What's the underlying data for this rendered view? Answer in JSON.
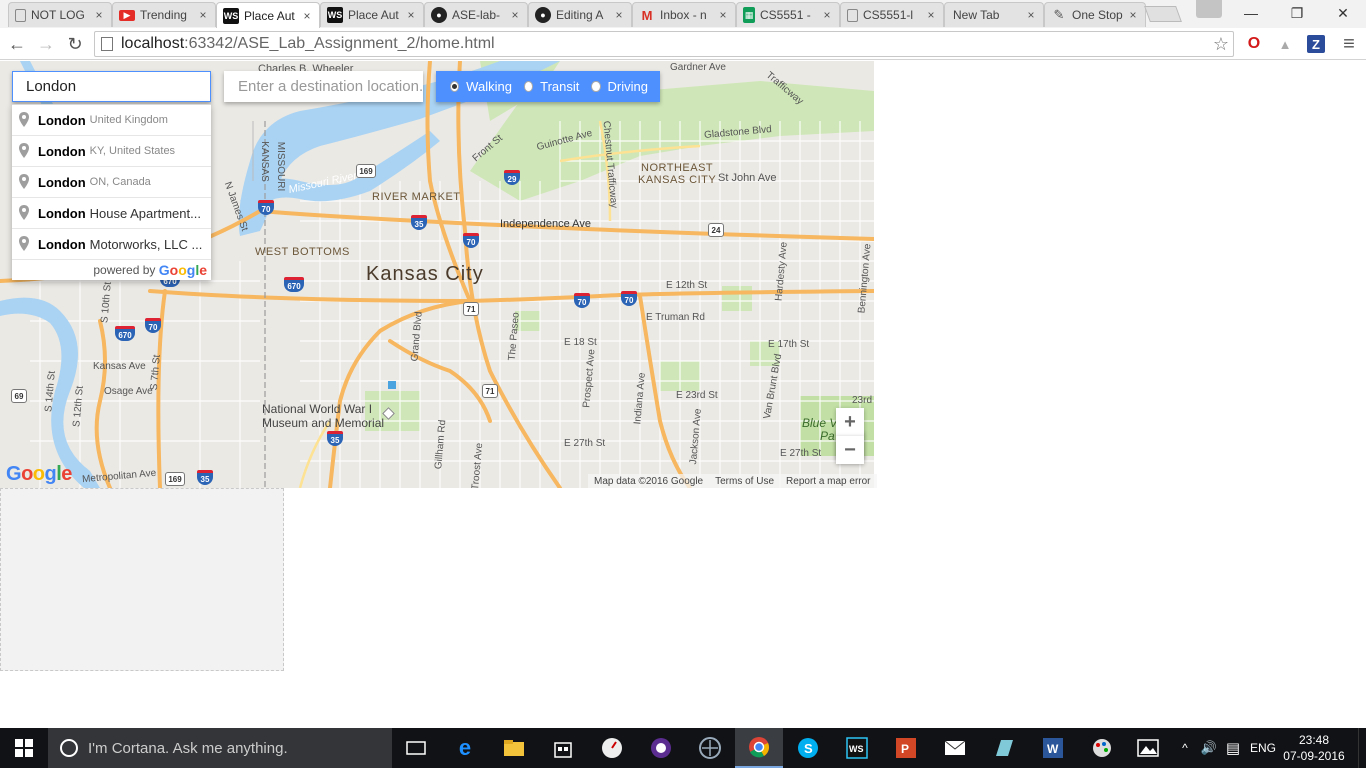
{
  "browser": {
    "tabs": [
      {
        "title": "NOT LOG",
        "favicon": "page-icon",
        "active": false
      },
      {
        "title": "Trending",
        "favicon": "youtube-icon",
        "active": false
      },
      {
        "title": "Place Aut",
        "favicon": "webstorm-icon",
        "active": true
      },
      {
        "title": "Place Aut",
        "favicon": "webstorm-icon",
        "active": false
      },
      {
        "title": "ASE-lab-",
        "favicon": "github-icon",
        "active": false
      },
      {
        "title": "Editing A",
        "favicon": "github-icon",
        "active": false
      },
      {
        "title": "Inbox - n",
        "favicon": "gmail-icon",
        "active": false
      },
      {
        "title": "CS5551 -",
        "favicon": "sheets-icon",
        "active": false
      },
      {
        "title": "CS5551-l",
        "favicon": "page-icon",
        "active": false
      },
      {
        "title": "New Tab",
        "favicon": "",
        "active": false
      },
      {
        "title": "One Stop",
        "favicon": "feather-icon",
        "active": false
      }
    ],
    "tab_close_glyph": "×",
    "window": {
      "minimize": "—",
      "restore": "❐",
      "close": "✕"
    },
    "url_host": "localhost",
    "url_path": ":63342/ASE_Lab_Assignment_2/home.html",
    "nav": {
      "back": "←",
      "forward": "→",
      "reload": "↻",
      "star": "☆",
      "menu": "≡"
    },
    "extensions": {
      "opera": "O",
      "drive": "▲",
      "z": "Z"
    }
  },
  "map": {
    "origin_value": "London",
    "destination_placeholder": "Enter a destination location...",
    "modes": [
      {
        "label": "Walking",
        "checked": true
      },
      {
        "label": "Transit",
        "checked": false
      },
      {
        "label": "Driving",
        "checked": false
      }
    ],
    "suggestions": [
      {
        "main": "London",
        "rest": "",
        "secondary": "United Kingdom"
      },
      {
        "main": "London",
        "rest": "",
        "secondary": "KY, United States"
      },
      {
        "main": "London",
        "rest": "",
        "secondary": "ON, Canada"
      },
      {
        "main": "London",
        "rest": "House Apartment...",
        "secondary": ""
      },
      {
        "main": "London",
        "rest": "Motorworks, LLC ...",
        "secondary": ""
      }
    ],
    "powered_by": "powered by",
    "google_letters": [
      "G",
      "o",
      "o",
      "g",
      "l",
      "e"
    ],
    "labels": {
      "city": "Kansas City",
      "river_market": "RIVER MARKET",
      "west_bottoms": "WEST BOTTOMS",
      "northeast_1": "NORTHEAST",
      "northeast_2": "KANSAS CITY",
      "missouri_river": "Missouri River",
      "independence": "Independence Ave",
      "e12th": "E 12th St",
      "truman": "E Truman Rd",
      "e18": "E 18 St",
      "e17": "E 17th St",
      "e23": "E 23rd St",
      "e27": "E 27th St",
      "e27b": "E 27th St",
      "stjohn": "St John Ave",
      "gladstone": "Gladstone Blvd",
      "guinotte": "Guinotte Ave",
      "front": "Front St",
      "chestnut": "Chestnut Trafficway",
      "gardner": "Gardner Ave",
      "wheeler": "Charles B. Wheeler",
      "wwi_1": "National World War I",
      "wwi_2": "Museum and Memorial",
      "kansas_ave": "Kansas Ave",
      "osage": "Osage Ave",
      "metropolitan": "Metropolitan Ave",
      "grand": "Grand Blvd",
      "paseo": "The Paseo",
      "prospect": "Prospect Ave",
      "indiana": "Indiana Ave",
      "jackson": "Jackson Ave",
      "vanbrunt": "Van Brunt Blvd",
      "hardesty": "Hardesty Ave",
      "bennington": "Bennington Ave",
      "gillham": "Gillham Rd",
      "troost": "Troost Ave",
      "s7th": "S 7th St",
      "s10th": "S 10th St",
      "s14th": "S 14th St",
      "s12th": "S 12th St",
      "njames": "N James St",
      "blue_v": "Blue V",
      "blue_pa": "Pa",
      "r23": "23rd",
      "missouri_v": "MISSOURI",
      "kansas_v": "KANSAS",
      "trafficway": "Trafficway"
    },
    "shields": {
      "i70a": "70",
      "i70b": "70",
      "i70c": "70",
      "i70d": "70",
      "i70e": "70",
      "i70f": "70",
      "i35a": "35",
      "i35b": "35",
      "i35c": "35",
      "i29": "29",
      "us169a": "169",
      "us169b": "169",
      "us71a": "71",
      "us71b": "71",
      "r24": "24",
      "i670a": "670",
      "i670b": "670",
      "i670c": "670",
      "r69": "69"
    },
    "zoom_in": "+",
    "zoom_out": "−",
    "footer": {
      "map_data": "Map data ©2016 Google",
      "terms": "Terms of Use",
      "report": "Report a map error"
    }
  },
  "taskbar": {
    "cortana_placeholder": "I'm Cortana. Ask me anything.",
    "apps": [
      "task-view",
      "edge",
      "file-explorer",
      "store",
      "clock-app",
      "onenote-app",
      "app-7",
      "chrome",
      "skype",
      "webstorm",
      "powerpoint",
      "mail",
      "app-13",
      "word",
      "paint-app",
      "photos"
    ],
    "tray": {
      "chevron": "^",
      "volume": "🔊",
      "notify": "▤",
      "lang": "ENG"
    },
    "time": "23:48",
    "date": "07-09-2016"
  }
}
